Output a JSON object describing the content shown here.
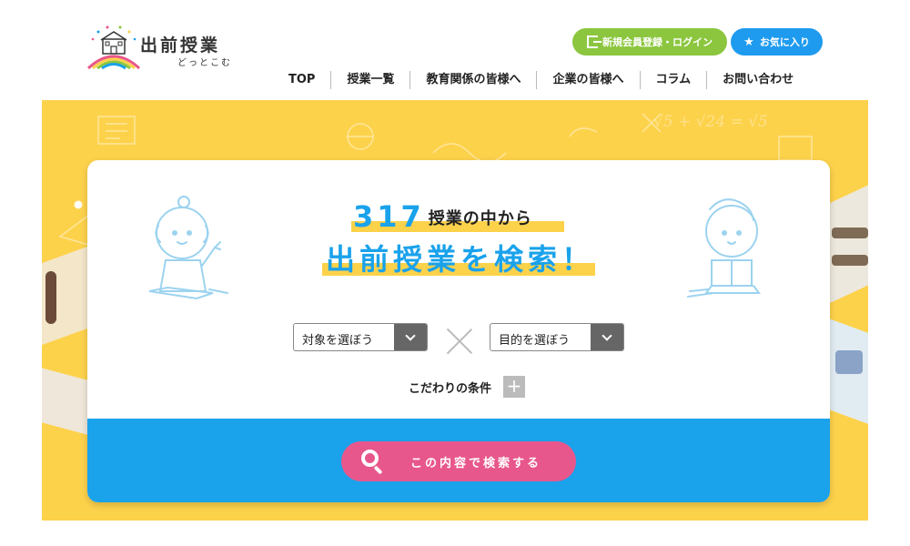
{
  "header": {
    "logo_title": "出前授業",
    "logo_sub": "どっとこむ",
    "login_button": "新規会員登録・ログイン",
    "favorites_button": "お気に入り",
    "nav": [
      "TOP",
      "授業一覧",
      "教育関係の皆様へ",
      "企業の皆様へ",
      "コラム",
      "お問い合わせ"
    ]
  },
  "search_panel": {
    "lesson_count": "317",
    "count_suffix": "授業の中から",
    "headline": "出前授業を検索！",
    "target_select": "対象を選ぼう",
    "purpose_select": "目的を選ぼう",
    "conditions_label": "こだわりの条件",
    "conditions_toggle": "+",
    "search_button": "この内容で検索する"
  },
  "colors": {
    "hero_yellow": "#fdd24b",
    "accent_blue": "#1aa2eb",
    "login_green": "#8cc63f",
    "favorites_blue": "#1e9bef",
    "search_pink": "#e8578b"
  },
  "icons": [
    "login-door-icon",
    "star-icon",
    "chevron-down-icon",
    "cross-icon",
    "plus-icon",
    "search-icon"
  ]
}
